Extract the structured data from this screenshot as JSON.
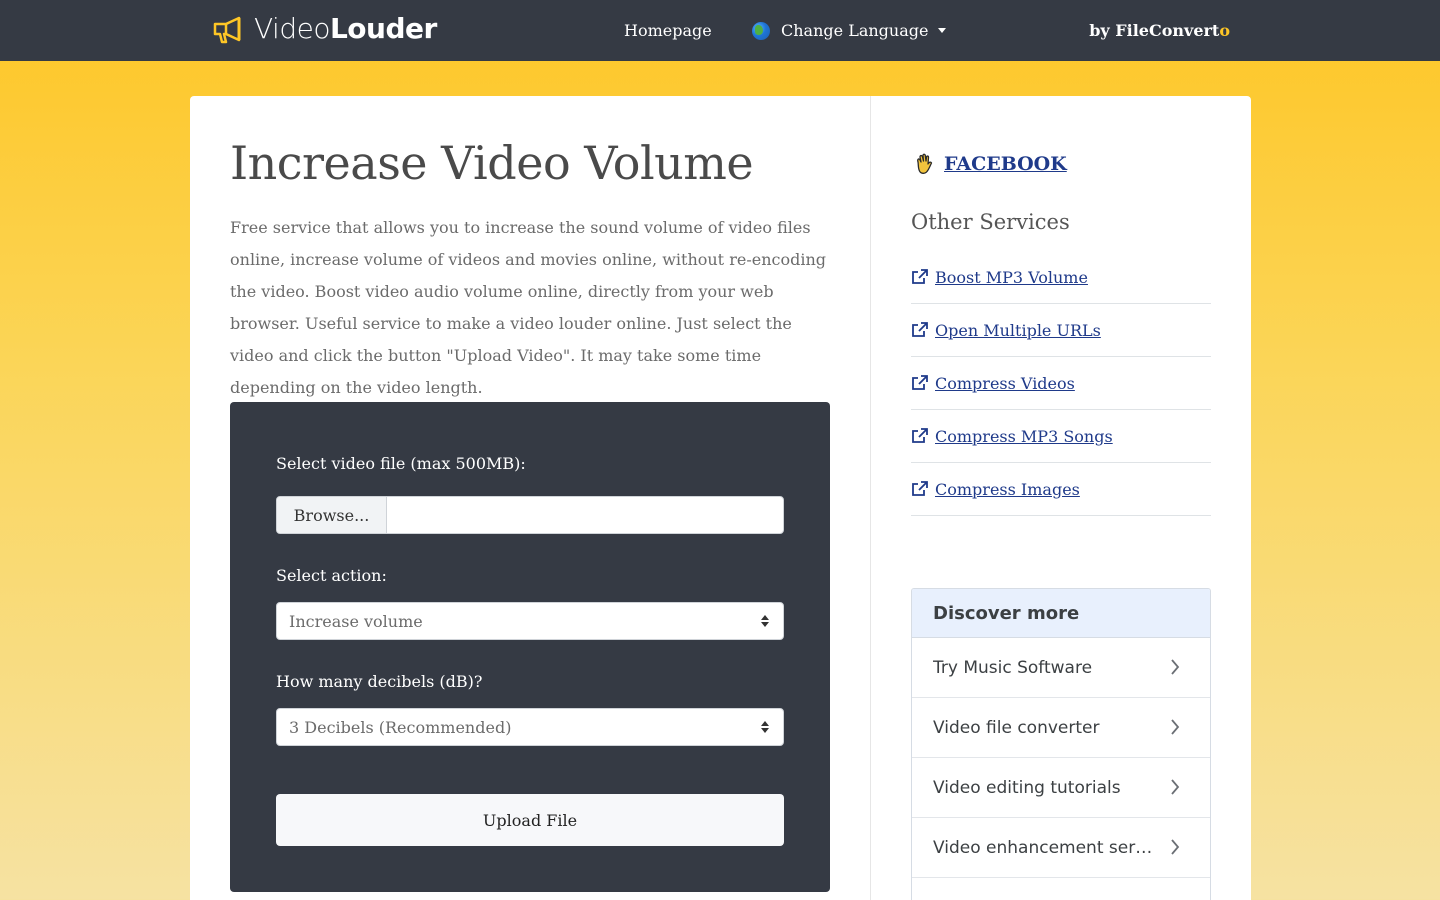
{
  "header": {
    "logo_light": "Video",
    "logo_bold": "Louder",
    "nav_home": "Homepage",
    "nav_language": "Change Language",
    "byline_prefix": "by FileConvert",
    "byline_suffix": "o"
  },
  "main": {
    "title": "Increase Video Volume",
    "description": "Free service that allows you to increase the sound volume of video files online, increase volume of videos and movies online, without re-encoding the video. Boost video audio volume online, directly from your web browser. Useful service to make a video louder online. Just select the video and click the button \"Upload Video\". It may take some time depending on the video length.",
    "form": {
      "file_label": "Select video file (max 500MB):",
      "browse_label": "Browse...",
      "action_label": "Select action:",
      "action_value": "Increase volume",
      "db_label": "How many decibels (dB)?",
      "db_value": "3 Decibels (Recommended)",
      "upload_label": "Upload File"
    }
  },
  "sidebar": {
    "facebook": "FACEBOOK",
    "other_title": "Other Services",
    "services": [
      {
        "label": "Boost MP3 Volume"
      },
      {
        "label": "Open Multiple URLs"
      },
      {
        "label": "Compress Videos"
      },
      {
        "label": "Compress MP3 Songs"
      },
      {
        "label": "Compress Images"
      }
    ],
    "discover": {
      "title": "Discover more",
      "items": [
        {
          "label": "Try Music Software"
        },
        {
          "label": "Video file converter"
        },
        {
          "label": "Video editing tutorials"
        },
        {
          "label": "Video enhancement services"
        }
      ]
    }
  },
  "colors": {
    "header_bg": "#353a44",
    "accent_yellow": "#fec626",
    "link_blue": "#1f3a8a"
  }
}
